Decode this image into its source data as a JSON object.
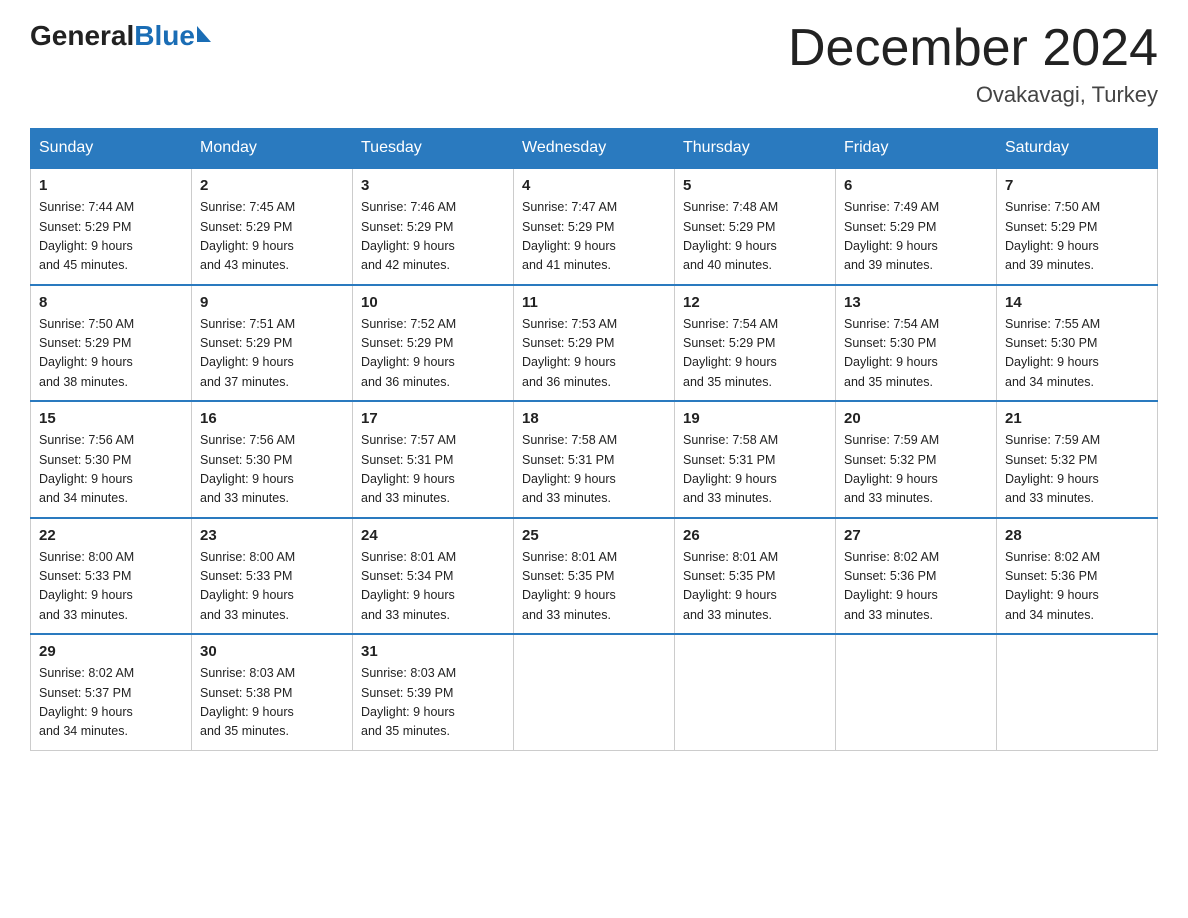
{
  "logo": {
    "general": "General",
    "blue": "Blue"
  },
  "title": "December 2024",
  "subtitle": "Ovakavagi, Turkey",
  "days_of_week": [
    "Sunday",
    "Monday",
    "Tuesday",
    "Wednesday",
    "Thursday",
    "Friday",
    "Saturday"
  ],
  "weeks": [
    [
      {
        "day": "1",
        "sunrise": "7:44 AM",
        "sunset": "5:29 PM",
        "daylight": "9 hours and 45 minutes."
      },
      {
        "day": "2",
        "sunrise": "7:45 AM",
        "sunset": "5:29 PM",
        "daylight": "9 hours and 43 minutes."
      },
      {
        "day": "3",
        "sunrise": "7:46 AM",
        "sunset": "5:29 PM",
        "daylight": "9 hours and 42 minutes."
      },
      {
        "day": "4",
        "sunrise": "7:47 AM",
        "sunset": "5:29 PM",
        "daylight": "9 hours and 41 minutes."
      },
      {
        "day": "5",
        "sunrise": "7:48 AM",
        "sunset": "5:29 PM",
        "daylight": "9 hours and 40 minutes."
      },
      {
        "day": "6",
        "sunrise": "7:49 AM",
        "sunset": "5:29 PM",
        "daylight": "9 hours and 39 minutes."
      },
      {
        "day": "7",
        "sunrise": "7:50 AM",
        "sunset": "5:29 PM",
        "daylight": "9 hours and 39 minutes."
      }
    ],
    [
      {
        "day": "8",
        "sunrise": "7:50 AM",
        "sunset": "5:29 PM",
        "daylight": "9 hours and 38 minutes."
      },
      {
        "day": "9",
        "sunrise": "7:51 AM",
        "sunset": "5:29 PM",
        "daylight": "9 hours and 37 minutes."
      },
      {
        "day": "10",
        "sunrise": "7:52 AM",
        "sunset": "5:29 PM",
        "daylight": "9 hours and 36 minutes."
      },
      {
        "day": "11",
        "sunrise": "7:53 AM",
        "sunset": "5:29 PM",
        "daylight": "9 hours and 36 minutes."
      },
      {
        "day": "12",
        "sunrise": "7:54 AM",
        "sunset": "5:29 PM",
        "daylight": "9 hours and 35 minutes."
      },
      {
        "day": "13",
        "sunrise": "7:54 AM",
        "sunset": "5:30 PM",
        "daylight": "9 hours and 35 minutes."
      },
      {
        "day": "14",
        "sunrise": "7:55 AM",
        "sunset": "5:30 PM",
        "daylight": "9 hours and 34 minutes."
      }
    ],
    [
      {
        "day": "15",
        "sunrise": "7:56 AM",
        "sunset": "5:30 PM",
        "daylight": "9 hours and 34 minutes."
      },
      {
        "day": "16",
        "sunrise": "7:56 AM",
        "sunset": "5:30 PM",
        "daylight": "9 hours and 33 minutes."
      },
      {
        "day": "17",
        "sunrise": "7:57 AM",
        "sunset": "5:31 PM",
        "daylight": "9 hours and 33 minutes."
      },
      {
        "day": "18",
        "sunrise": "7:58 AM",
        "sunset": "5:31 PM",
        "daylight": "9 hours and 33 minutes."
      },
      {
        "day": "19",
        "sunrise": "7:58 AM",
        "sunset": "5:31 PM",
        "daylight": "9 hours and 33 minutes."
      },
      {
        "day": "20",
        "sunrise": "7:59 AM",
        "sunset": "5:32 PM",
        "daylight": "9 hours and 33 minutes."
      },
      {
        "day": "21",
        "sunrise": "7:59 AM",
        "sunset": "5:32 PM",
        "daylight": "9 hours and 33 minutes."
      }
    ],
    [
      {
        "day": "22",
        "sunrise": "8:00 AM",
        "sunset": "5:33 PM",
        "daylight": "9 hours and 33 minutes."
      },
      {
        "day": "23",
        "sunrise": "8:00 AM",
        "sunset": "5:33 PM",
        "daylight": "9 hours and 33 minutes."
      },
      {
        "day": "24",
        "sunrise": "8:01 AM",
        "sunset": "5:34 PM",
        "daylight": "9 hours and 33 minutes."
      },
      {
        "day": "25",
        "sunrise": "8:01 AM",
        "sunset": "5:35 PM",
        "daylight": "9 hours and 33 minutes."
      },
      {
        "day": "26",
        "sunrise": "8:01 AM",
        "sunset": "5:35 PM",
        "daylight": "9 hours and 33 minutes."
      },
      {
        "day": "27",
        "sunrise": "8:02 AM",
        "sunset": "5:36 PM",
        "daylight": "9 hours and 33 minutes."
      },
      {
        "day": "28",
        "sunrise": "8:02 AM",
        "sunset": "5:36 PM",
        "daylight": "9 hours and 34 minutes."
      }
    ],
    [
      {
        "day": "29",
        "sunrise": "8:02 AM",
        "sunset": "5:37 PM",
        "daylight": "9 hours and 34 minutes."
      },
      {
        "day": "30",
        "sunrise": "8:03 AM",
        "sunset": "5:38 PM",
        "daylight": "9 hours and 35 minutes."
      },
      {
        "day": "31",
        "sunrise": "8:03 AM",
        "sunset": "5:39 PM",
        "daylight": "9 hours and 35 minutes."
      },
      null,
      null,
      null,
      null
    ]
  ]
}
